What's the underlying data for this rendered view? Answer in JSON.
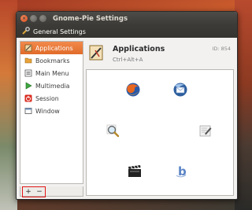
{
  "window": {
    "title": "Gnome-Pie Settings"
  },
  "toolbar": {
    "label": "General Settings",
    "icon": "wrench-icon"
  },
  "sidebar": {
    "items": [
      {
        "label": "Applications",
        "icon": "applications-icon",
        "active": true
      },
      {
        "label": "Bookmarks",
        "icon": "bookmarks-icon"
      },
      {
        "label": "Main Menu",
        "icon": "main-menu-icon"
      },
      {
        "label": "Multimedia",
        "icon": "multimedia-icon"
      },
      {
        "label": "Session",
        "icon": "session-icon"
      },
      {
        "label": "Window",
        "icon": "window-icon"
      }
    ],
    "add_label": "+",
    "remove_label": "−"
  },
  "pie": {
    "title": "Applications",
    "shortcut": "Ctrl+Alt+A",
    "id": "ID: 854",
    "slices": [
      {
        "icon": "firefox-icon"
      },
      {
        "icon": "thunderbird-icon"
      },
      {
        "icon": "search-tool-icon"
      },
      {
        "icon": "text-editor-icon"
      },
      {
        "icon": "movie-player-icon"
      },
      {
        "icon": "bazaar-icon"
      }
    ]
  },
  "colors": {
    "accent": "#e8742f",
    "titlebar": "#3c3b37",
    "highlight_border": "#e11515"
  }
}
